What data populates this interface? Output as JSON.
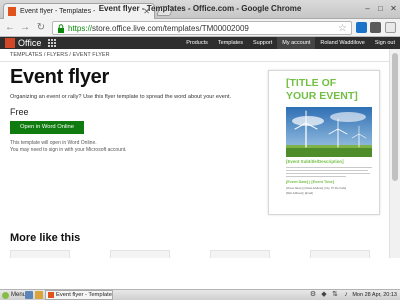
{
  "browser": {
    "tab_title": "Event flyer - Templates -",
    "window_title": "Event flyer - Templates - Office.com - Google Chrome",
    "url_https": "https://",
    "url_rest": "store.office.live.com/templates/TM00002009"
  },
  "office": {
    "brand": "Office",
    "nav": [
      "Products",
      "Templates",
      "Support",
      "My account",
      "Roland Waddilove",
      "Sign out"
    ],
    "brand_color": "#d24726",
    "bar_color": "#2e2e2e"
  },
  "breadcrumb": "Templates / Flyers / Event flyer",
  "template": {
    "title": "Event flyer",
    "description": "Organizing an event or rally? Use this flyer template to spread the word about your event.",
    "price": "Free",
    "open_button": "Open in Word Online",
    "note_line1": "This template will open in Word Online.",
    "note_line2": "You may need to sign in with your Microsoft account."
  },
  "preview": {
    "title_line1": "[TITLE OF",
    "title_line2": "YOUR EVENT]",
    "subtitle": "[Event Subtitle/Description]",
    "date_time": "[Event Date] | [Event Time]",
    "address_line": "[Venue Name] | [Street Address], [City, ST Zip Code]",
    "web_line": "[Web Address] | [Email]",
    "accent_color": "#72bf44"
  },
  "more": {
    "title": "More like this"
  },
  "taskbar": {
    "menu_label": "Menu",
    "task_label": "Event flyer - Template...",
    "clock": "Mon 28 Apr, 20:13"
  }
}
